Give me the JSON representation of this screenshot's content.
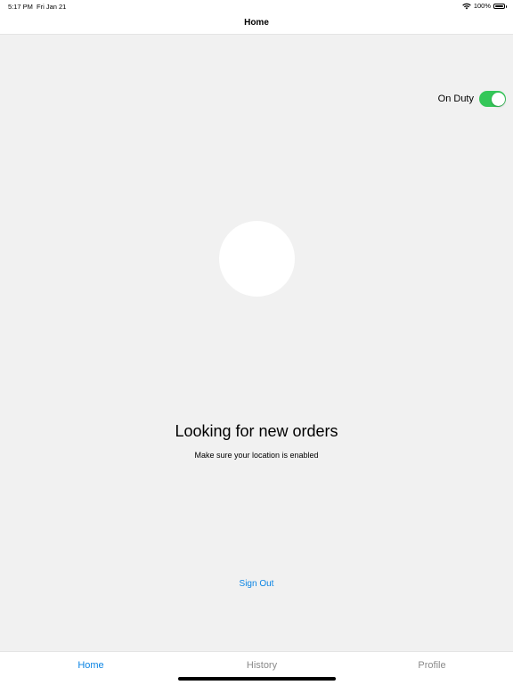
{
  "status_bar": {
    "time": "5:17 PM",
    "date": "Fri Jan 21",
    "battery": "100%",
    "icons": [
      "wifi-icon",
      "battery-icon"
    ]
  },
  "nav": {
    "title": "Home"
  },
  "duty": {
    "label": "On Duty",
    "enabled": true,
    "toggle_color": "#35c759"
  },
  "main": {
    "heading": "Looking for new orders",
    "subheading": "Make sure your location is enabled",
    "sign_out": "Sign Out"
  },
  "tabs": [
    {
      "label": "Home",
      "active": true
    },
    {
      "label": "History",
      "active": false
    },
    {
      "label": "Profile",
      "active": false
    }
  ],
  "colors": {
    "accent": "#0a84e4",
    "inactive_tab": "#8a8a8a",
    "background": "#f1f1f1"
  }
}
